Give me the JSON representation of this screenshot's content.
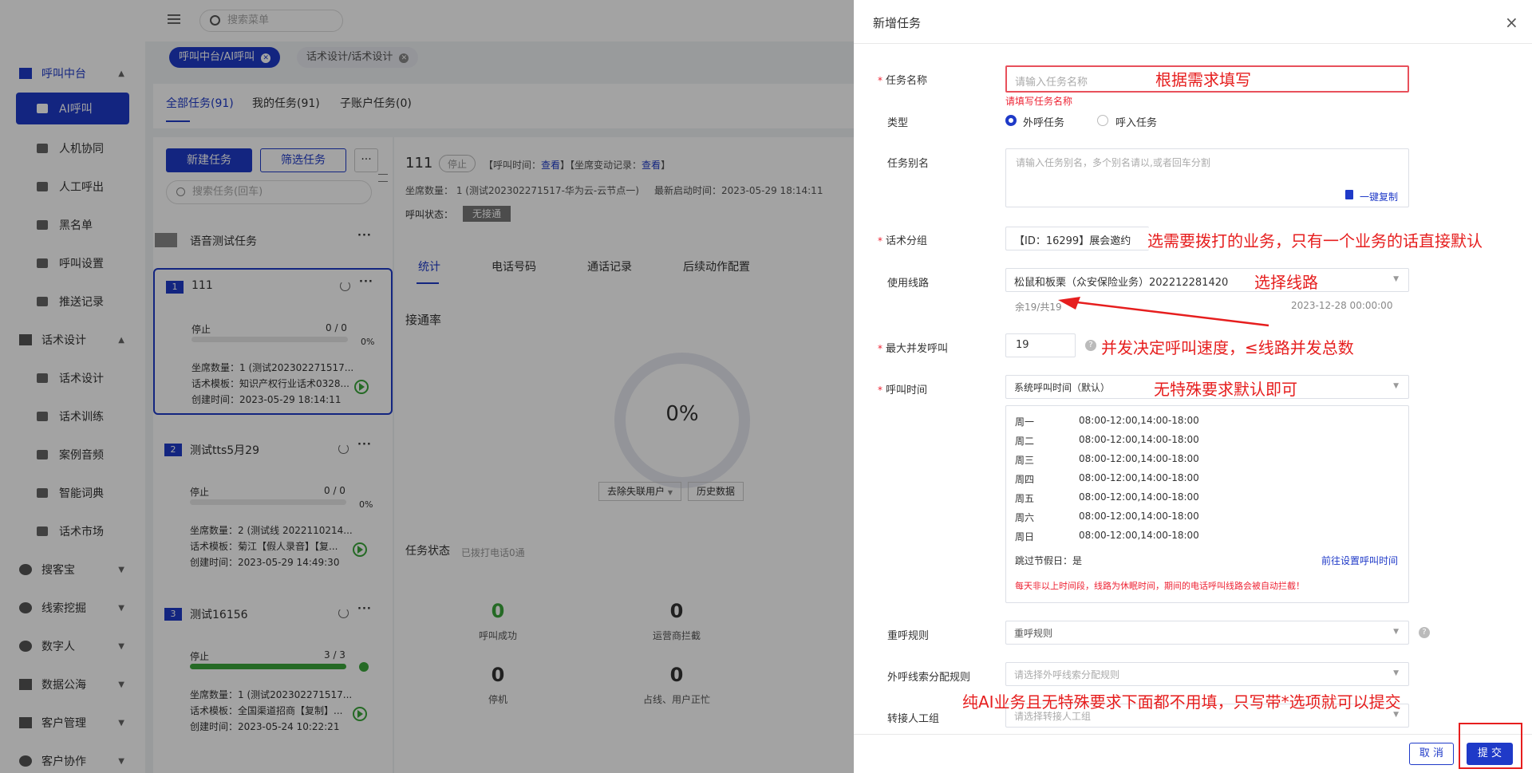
{
  "sidebar": {
    "groups": [
      {
        "label": "呼叫中台",
        "chevron": "^"
      },
      {
        "label": "话术设计",
        "chevron": "^"
      }
    ],
    "call_items": [
      "AI呼叫",
      "人机协同",
      "人工呼出",
      "黑名单",
      "呼叫设置",
      "推送记录"
    ],
    "script_items": [
      "话术设计",
      "话术训练",
      "案例音频",
      "智能词典",
      "话术市场"
    ],
    "collapsed_groups": [
      "搜客宝",
      "线索挖掘",
      "数字人",
      "数据公海",
      "客户管理",
      "客户协作"
    ],
    "active_item": "AI呼叫"
  },
  "topbar": {
    "search_placeholder": "搜索菜单"
  },
  "open_tabs": [
    {
      "label": "呼叫中台/AI呼叫",
      "active": true
    },
    {
      "label": "话术设计/话术设计",
      "active": false
    }
  ],
  "page_tabs": [
    "全部任务(91)",
    "我的任务(91)",
    "子账户任务(0)"
  ],
  "task_panel": {
    "new_task": "新建任务",
    "filter_task": "筛选任务",
    "more": "···",
    "search_placeholder": "搜索任务(回车)",
    "group_name": "语音测试任务",
    "tasks": [
      {
        "num": "1",
        "name": "111",
        "status": "停止",
        "count": "0 / 0",
        "pct": "0%",
        "progress": 0,
        "seats": "坐席数量：1 (测试202302271517...",
        "template": "话术模板：知识产权行业话术0328...",
        "created": "创建时间：2023-05-29 18:14:11"
      },
      {
        "num": "2",
        "name": "测试tts5月29",
        "status": "停止",
        "count": "0 / 0",
        "pct": "0%",
        "progress": 0,
        "seats": "坐席数量：2 (测试线 2022110214...",
        "template": "话术模板：菊江【假人录音】【复...",
        "created": "创建时间：2023-05-29 14:49:30"
      },
      {
        "num": "3",
        "name": "测试16156",
        "status": "停止",
        "count": "3 / 3",
        "pct": "",
        "progress": 100,
        "seats": "坐席数量：1 (测试202302271517...",
        "template": "话术模板：全国渠道招商【复制】...",
        "created": "创建时间：2023-05-24 10:22:21"
      }
    ]
  },
  "detail": {
    "title": "111",
    "badge": "停止",
    "call_time_label": "【呼叫时间：",
    "view": "查看",
    "seat_change_label": "】【坐席变动记录：",
    "meta_close": "】",
    "seats": "坐席数量： 1 (测试202302271517-华为云-云节点一)",
    "last_start": "最新启动时间：2023-05-29 18:14:11",
    "call_state_label": "呼叫状态：",
    "call_state": "无接通",
    "tabs": [
      "统计",
      "电话号码",
      "通话记录",
      "后续动作配置"
    ],
    "connect_rate_label": "接通率",
    "connect_rate": "0%",
    "filter_select": "去除失联用户",
    "history": "历史数据",
    "task_state_label": "任务状态",
    "dialed": "已拨打电话0通",
    "stats": [
      {
        "value": "0",
        "label": "呼叫成功"
      },
      {
        "value": "0",
        "label": "运营商拦截"
      },
      {
        "value": "0",
        "label": "停机"
      },
      {
        "value": "0",
        "label": "占线、用户正忙"
      }
    ]
  },
  "drawer": {
    "title": "新增任务",
    "close": "×",
    "task_name_label": "任务名称",
    "task_name_placeholder": "请输入任务名称",
    "task_name_error": "请填写任务名称",
    "type_label": "类型",
    "type_options": [
      "外呼任务",
      "呼入任务"
    ],
    "alias_label": "任务别名",
    "alias_placeholder": "请输入任务别名，多个别名请以,或者回车分割",
    "copy_link": "一键复制",
    "script_group_label": "话术分组",
    "script_group_value": "【ID：16299】展会邀约",
    "line_label": "使用线路",
    "line_value": "松鼠和板栗（众安保险业务）202212281420",
    "line_remaining": "余19/共19",
    "line_date": "2023-12-28 00:00:00",
    "max_concurrent_label": "最大并发呼叫",
    "max_concurrent_value": "19",
    "call_time_label": "呼叫时间",
    "call_time_value": "系统呼叫时间（默认）",
    "schedule": [
      {
        "day": "周一",
        "time": "08:00-12:00,14:00-18:00"
      },
      {
        "day": "周二",
        "time": "08:00-12:00,14:00-18:00"
      },
      {
        "day": "周三",
        "time": "08:00-12:00,14:00-18:00"
      },
      {
        "day": "周四",
        "time": "08:00-12:00,14:00-18:00"
      },
      {
        "day": "周五",
        "time": "08:00-12:00,14:00-18:00"
      },
      {
        "day": "周六",
        "time": "08:00-12:00,14:00-18:00"
      },
      {
        "day": "周日",
        "time": "08:00-12:00,14:00-18:00"
      }
    ],
    "skip_holiday": "跳过节假日：是",
    "go_set_time": "前往设置呼叫时间",
    "warning": "每天非以上时间段，线路为休眠时间，期间的电话呼叫线路会被自动拦截！",
    "redial_label": "重呼规则",
    "redial_placeholder": "重呼规则",
    "lead_rule_label": "外呼线索分配规则",
    "lead_rule_placeholder": "请选择外呼线索分配规则",
    "transfer_label": "转接人工组",
    "transfer_placeholder": "请选择转接人工组",
    "cancel": "取 消",
    "submit": "提 交"
  },
  "annotations": {
    "name": "根据需求填写",
    "script": "选需要拨打的业务，只有一个业务的话直接默认",
    "line": "选择线路",
    "concurrent": "并发决定呼叫速度，≤线路并发总数",
    "call_time": "无特殊要求默认即可",
    "bottom": "纯AI业务且无特殊要求下面都不用填，只写带*选项就可以提交",
    "color": "#e61e1e"
  },
  "colors": {
    "primary": "#1f3ac8",
    "error": "#e23",
    "success": "#3aa63a"
  }
}
